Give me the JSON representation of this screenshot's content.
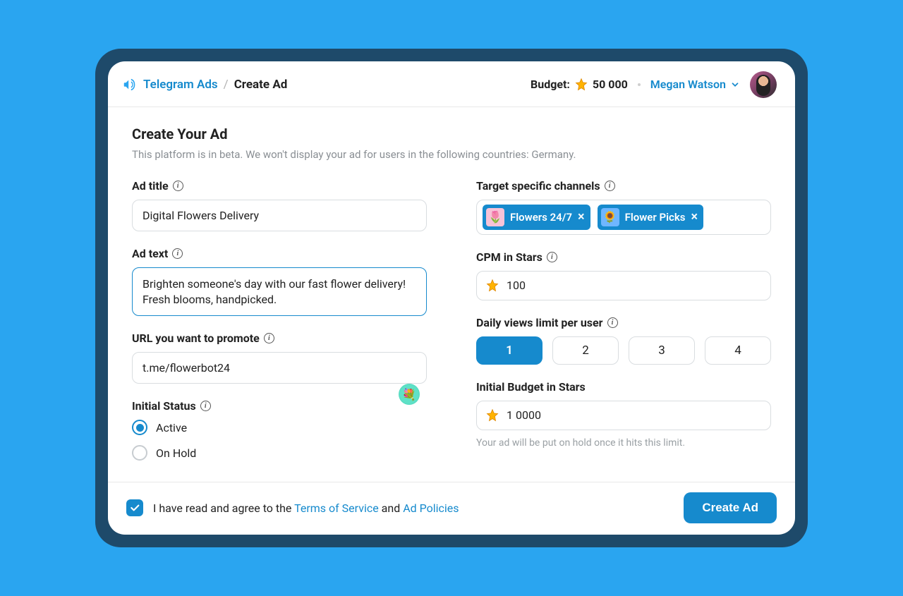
{
  "header": {
    "brand": "Telegram Ads",
    "crumb_current": "Create Ad",
    "budget_label": "Budget:",
    "budget_value": "50 000",
    "user_name": "Megan Watson"
  },
  "page": {
    "title": "Create Your Ad",
    "subtitle": "This platform is in beta. We won't display your ad for users in the following countries: Germany."
  },
  "left": {
    "ad_title_label": "Ad title",
    "ad_title_value": "Digital Flowers Delivery",
    "ad_text_label": "Ad text",
    "ad_text_value": "Brighten someone's day with our fast flower delivery! Fresh blooms, handpicked.",
    "url_label": "URL you want to promote",
    "url_value": "t.me/flowerbot24",
    "status_label": "Initial Status",
    "status_options": {
      "active": "Active",
      "on_hold": "On Hold"
    },
    "status_selected": "active"
  },
  "right": {
    "channels_label": "Target specific channels",
    "channels": [
      {
        "name": "Flowers 24/7",
        "thumb": "pink",
        "emoji": "🌷"
      },
      {
        "name": "Flower Picks",
        "thumb": "sky",
        "emoji": "🌻"
      }
    ],
    "cpm_label": "CPM in Stars",
    "cpm_value": "100",
    "views_label": "Daily views limit per user",
    "views_options": [
      "1",
      "2",
      "3",
      "4"
    ],
    "views_selected": "1",
    "budget_label": "Initial Budget in Stars",
    "budget_value": "1 0000",
    "budget_hint": "Your ad will be put on hold once it hits this limit."
  },
  "footer": {
    "agree_prefix": "I have read and agree to the ",
    "tos": "Terms of Service",
    "agree_mid": " and ",
    "ad_policies": "Ad Policies",
    "checked": true,
    "create_label": "Create Ad"
  }
}
